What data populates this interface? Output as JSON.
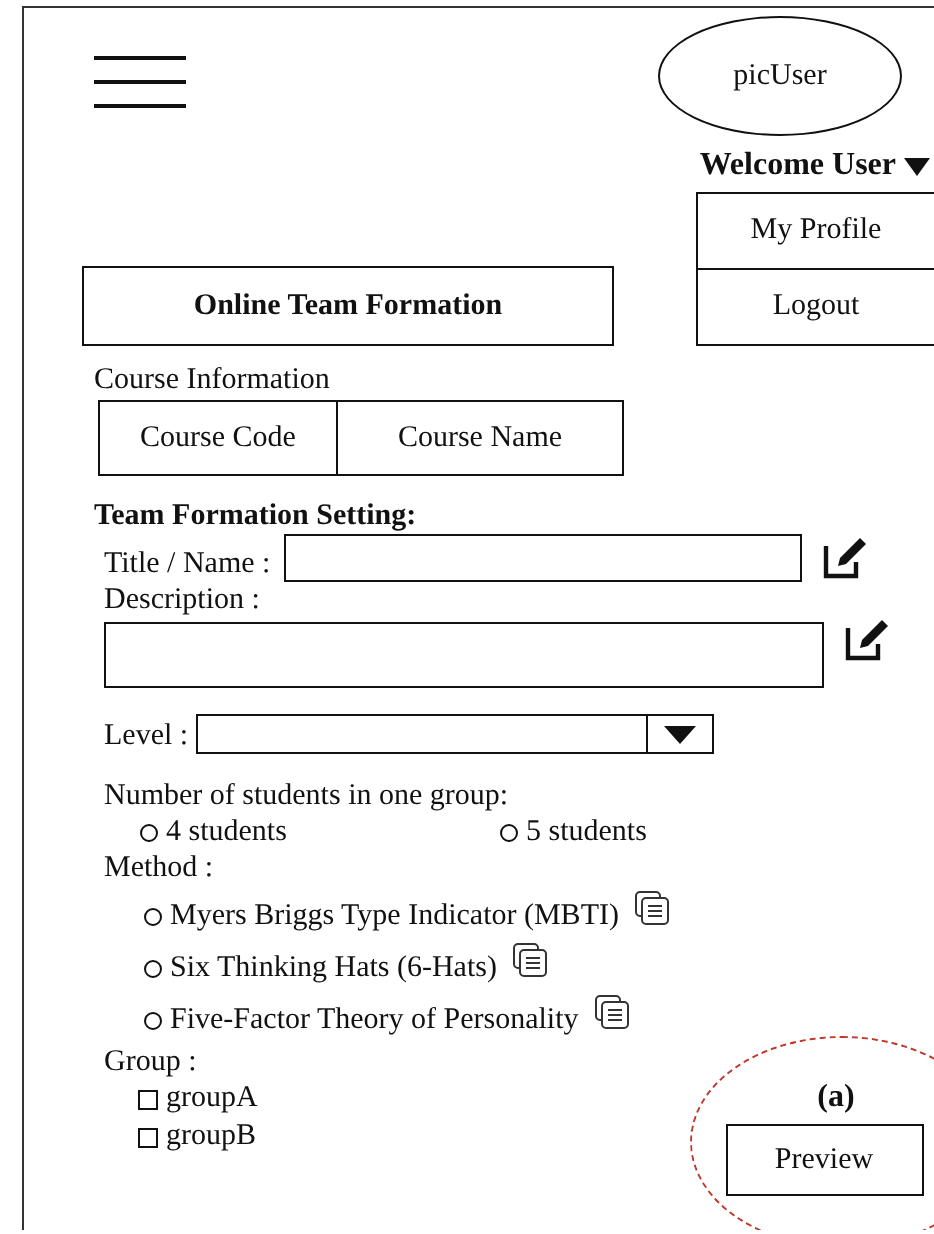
{
  "header": {
    "avatar": "picUser",
    "welcome": "Welcome User"
  },
  "user_menu": [
    {
      "label": "My Profile"
    },
    {
      "label": "Logout"
    }
  ],
  "page_title": "Online Team Formation",
  "course_info": {
    "label": "Course Information",
    "columns": [
      "Course Code",
      "Course Name"
    ]
  },
  "settings": {
    "heading": "Team Formation Setting:",
    "title_label": "Title / Name :",
    "description_label": "Description :",
    "level_label": "Level :",
    "group_size_label": "Number of students in one group:",
    "group_sizes": [
      {
        "label": "4 students",
        "selected": false
      },
      {
        "label": "5 students",
        "selected": false
      }
    ],
    "method_label": "Method :",
    "methods": [
      {
        "label": "Myers Briggs Type Indicator (MBTI)",
        "selected": false
      },
      {
        "label": "Six Thinking Hats (6-Hats)",
        "selected": false
      },
      {
        "label": "Five-Factor Theory of Personality",
        "selected": false
      }
    ],
    "group_label": "Group :",
    "groups": [
      {
        "label": "groupA",
        "checked": false
      },
      {
        "label": "groupB",
        "checked": false
      }
    ]
  },
  "annotation": "(a)",
  "preview_button": "Preview"
}
